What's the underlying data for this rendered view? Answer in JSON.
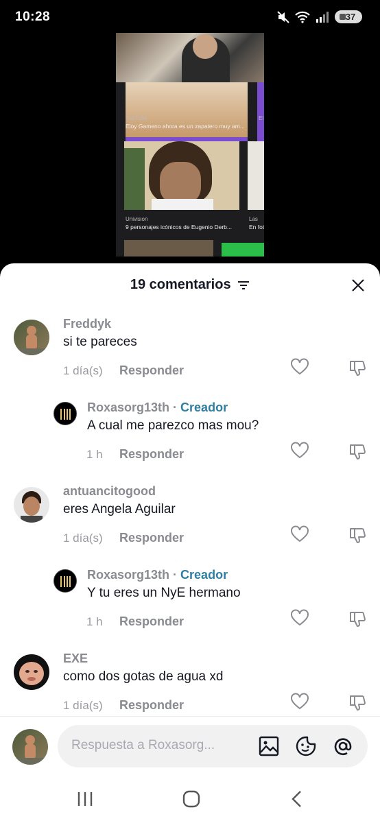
{
  "status_bar": {
    "time": "10:28",
    "battery": "37"
  },
  "video": {
    "items": [
      {
        "source": "YouTube",
        "caption": "Eloy Gameno ahora es un zapatero muy am..."
      },
      {
        "source": "Univision",
        "caption": "9 personajes icónicos de Eugenio Derb..."
      }
    ],
    "side_items": [
      {
        "source": "El",
        "caption": ""
      },
      {
        "source": "Las",
        "caption": "En fot"
      }
    ]
  },
  "comments_sheet": {
    "title": "19 comentarios",
    "comments": [
      {
        "username": "Freddyk",
        "text": "si te pareces",
        "time": "1 día(s)",
        "reply_label": "Responder",
        "creator": false
      },
      {
        "username": "Roxasorg13th",
        "creator_label": "Creador",
        "text": "A cual me parezco mas mou?",
        "time": "1 h",
        "reply_label": "Responder",
        "creator": true
      },
      {
        "username": "antuancitogood",
        "text": "eres Angela Aguilar",
        "time": "1 día(s)",
        "reply_label": "Responder",
        "creator": false
      },
      {
        "username": "Roxasorg13th",
        "creator_label": "Creador",
        "text": "Y tu eres un NyE hermano",
        "time": "1 h",
        "reply_label": "Responder",
        "creator": true
      },
      {
        "username": "EXE",
        "text": "como dos gotas de agua xd",
        "time": "1 día(s)",
        "reply_label": "Responder",
        "creator": false
      }
    ]
  },
  "input": {
    "placeholder": "Respuesta a Roxasorg..."
  },
  "colors": {
    "creator": "#2f7fa1",
    "sheet_bg": "#ffffff",
    "text": "#161823",
    "muted": "#8a8b91"
  }
}
